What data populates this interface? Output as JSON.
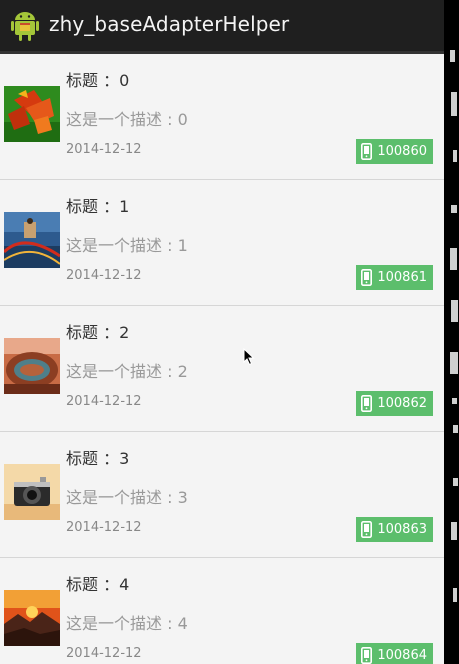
{
  "app": {
    "title": "zhy_baseAdapterHelper"
  },
  "items": [
    {
      "title": "标题 ：0",
      "desc": "这是一个描述 : 0",
      "date": "2014-12-12",
      "phone": "100860",
      "thumb": "autumn-leaves"
    },
    {
      "title": "标题 ：1",
      "desc": "这是一个描述 : 1",
      "date": "2014-12-12",
      "phone": "100861",
      "thumb": "rollercoaster"
    },
    {
      "title": "标题 ：2",
      "desc": "这是一个描述 : 2",
      "date": "2014-12-12",
      "phone": "100862",
      "thumb": "canyon-bend"
    },
    {
      "title": "标题 ：3",
      "desc": "这是一个描述 : 3",
      "date": "2014-12-12",
      "phone": "100863",
      "thumb": "vintage-camera"
    },
    {
      "title": "标题 ：4",
      "desc": "这是一个描述 : 4",
      "date": "2014-12-12",
      "phone": "100864",
      "thumb": "sunset-mountains"
    }
  ],
  "colors": {
    "accent": "#5cbe6c",
    "actionbar": "#1f1f1f",
    "background": "#f3f3f3"
  },
  "icons": {
    "app": "android-icon",
    "badge": "phone-icon"
  }
}
